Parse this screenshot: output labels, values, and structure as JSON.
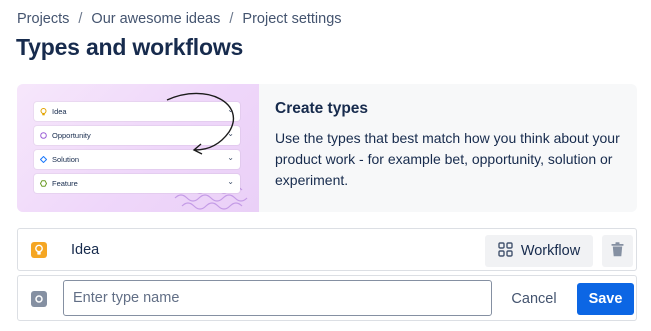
{
  "breadcrumb": {
    "items": [
      "Projects",
      "Our awesome ideas",
      "Project settings"
    ],
    "separator": "/"
  },
  "page": {
    "title": "Types and workflows"
  },
  "banner": {
    "title": "Create types",
    "description": "Use the types that best match how you think about your product work - for example bet, opportunity, solution or experiment.",
    "illustration_rows": [
      {
        "label": "Idea",
        "icon": "bulb-icon"
      },
      {
        "label": "Opportunity",
        "icon": "circle-icon"
      },
      {
        "label": "Solution",
        "icon": "diamond-icon"
      },
      {
        "label": "Feature",
        "icon": "hexagon-icon"
      }
    ]
  },
  "type_row": {
    "name": "Idea",
    "icon": "bulb-icon",
    "icon_color": "#f5a623",
    "workflow_label": "Workflow"
  },
  "new_type": {
    "placeholder": "Enter type name",
    "value": "",
    "cancel_label": "Cancel",
    "save_label": "Save"
  },
  "colors": {
    "accent": "#0c66e4",
    "banner_bg": "#f7f8f9",
    "illustration_bg": "#efd7fa"
  }
}
